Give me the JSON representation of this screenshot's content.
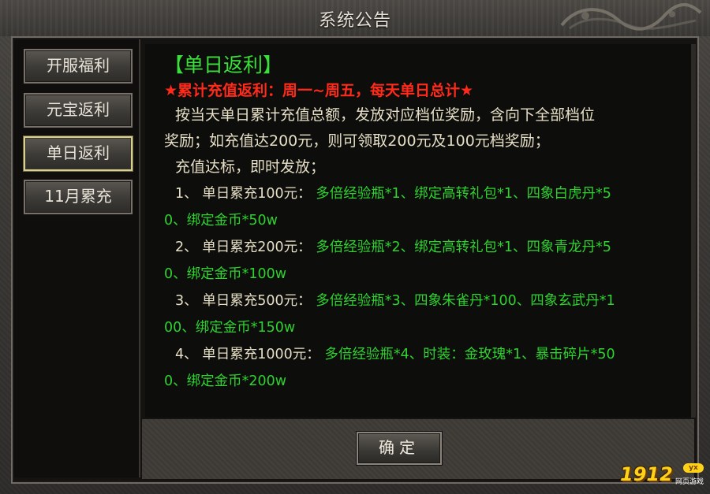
{
  "window": {
    "title": "系统公告"
  },
  "sidebar": {
    "tabs": [
      {
        "label": "开服福利",
        "active": false
      },
      {
        "label": "元宝返利",
        "active": false
      },
      {
        "label": "单日返利",
        "active": true
      },
      {
        "label": "11月累充",
        "active": false
      }
    ]
  },
  "content": {
    "heading": "【单日返利】",
    "subheading": "★累计充值返利：周一~周五，每天单日总计★",
    "para1": "按当天单日累计充值总额，发放对应档位奖励，含向下全部档位",
    "para2": "奖励；如充值达200元，则可领取200元及100元档奖励；",
    "para3": "充值达标，即时发放；",
    "items": [
      {
        "num": "1、",
        "tier": "单日累充100元：",
        "line1": "多倍经验瓶*1、绑定高转礼包*1、四象白虎丹*5",
        "line2": "0、绑定金币*50w"
      },
      {
        "num": "2、",
        "tier": "单日累充200元：",
        "line1": "多倍经验瓶*2、绑定高转礼包*1、四象青龙丹*5",
        "line2": "0、绑定金币*100w"
      },
      {
        "num": "3、",
        "tier": "单日累充500元：",
        "line1": "多倍经验瓶*3、四象朱雀丹*100、四象玄武丹*1",
        "line2": "00、绑定金币*150w"
      },
      {
        "num": "4、",
        "tier": "单日累充1000元：",
        "line1": "多倍经验瓶*4、时装：金玫瑰*1、暴击碎片*50",
        "line2": "0、绑定金币*200w"
      }
    ]
  },
  "footer": {
    "ok_label": "确定"
  },
  "watermark": {
    "main": "1912",
    "badge": "yx",
    "sub": "网页游戏"
  },
  "colors": {
    "heading": "#39e039",
    "subheading": "#ff2a1a",
    "body": "#e6dfc5",
    "reward": "#2fd22f",
    "active_tab_border": "#d9cf8f"
  }
}
